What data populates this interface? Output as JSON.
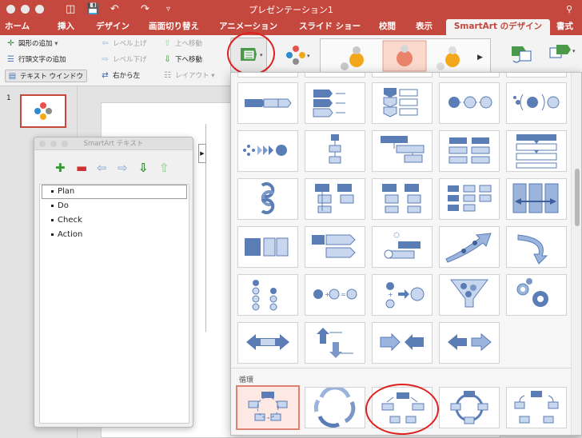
{
  "window": {
    "title": "プレゼンテーション1"
  },
  "tabs": [
    {
      "label": "ホーム",
      "active": false
    },
    {
      "label": "挿入",
      "active": false
    },
    {
      "label": "デザイン",
      "active": false
    },
    {
      "label": "画面切り替え",
      "active": false
    },
    {
      "label": "アニメーション",
      "active": false
    },
    {
      "label": "スライド ショー",
      "active": false
    },
    {
      "label": "校閲",
      "active": false
    },
    {
      "label": "表示",
      "active": false
    },
    {
      "label": "SmartArt のデザイン",
      "active": true
    },
    {
      "label": "書式",
      "active": false
    }
  ],
  "ribbon": {
    "add_shape": "図形の追加",
    "add_bullet": "行頭文字の追加",
    "text_pane": "テキスト ウインドウ",
    "promote": "レベル上げ",
    "demote": "レベル下げ",
    "right_to_left": "右から左",
    "move_up": "上へ移動",
    "move_down": "下へ移動",
    "layout": "レイアウト"
  },
  "slides": {
    "number": "1"
  },
  "text_pane": {
    "title": "SmartArt テキスト",
    "items": [
      "Plan",
      "Do",
      "Check",
      "Action"
    ]
  },
  "layout_gallery": {
    "section_label": "循環",
    "selected_index": 2
  },
  "colors": {
    "accent": "#c4483e",
    "shape_blue": "#5b7db6",
    "shape_light": "#c9d7ee",
    "highlight": "#e02020"
  }
}
